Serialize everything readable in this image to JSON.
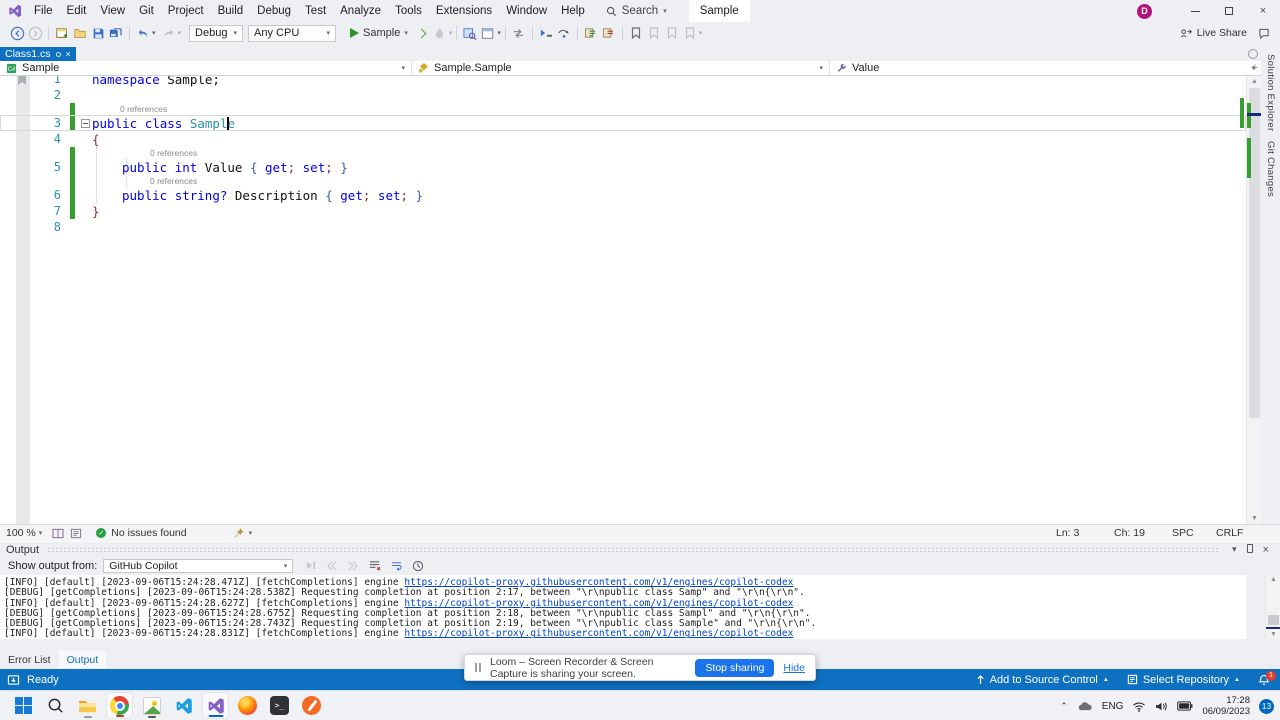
{
  "colors": {
    "accent": "#0e70c0",
    "keyword": "#0000ee",
    "type_name": "#2b91af",
    "changed_bar": "#35a02f",
    "log_link": "#0044cc",
    "share_button": "#1a73e8"
  },
  "titlebar": {
    "menus": [
      "File",
      "Edit",
      "View",
      "Git",
      "Project",
      "Build",
      "Debug",
      "Test",
      "Analyze",
      "Tools",
      "Extensions",
      "Window",
      "Help"
    ],
    "search": "Search",
    "solution": "Sample",
    "avatar": "D",
    "live_share": "Live Share"
  },
  "toolbar": {
    "config": "Debug",
    "platform": "Any CPU",
    "run": "Sample"
  },
  "doc_tab": "Class1.cs",
  "navbar": {
    "project": "Sample",
    "type": "Sample.Sample",
    "member": "Value"
  },
  "editor": {
    "codelens": "0 references",
    "lines": [
      {
        "n": "1",
        "tokens": [
          [
            "k",
            "namespace"
          ],
          [
            "p",
            " Sample;"
          ]
        ]
      },
      {
        "n": "2",
        "tokens": []
      },
      {
        "n": "3",
        "codelens": true,
        "changed": true,
        "current": true,
        "outline": true,
        "tokens": [
          [
            "k",
            "public"
          ],
          [
            "p",
            " "
          ],
          [
            "k",
            "class"
          ],
          [
            "p",
            " "
          ],
          [
            "t",
            "Sample"
          ]
        ]
      },
      {
        "n": "4",
        "tokens": [
          [
            "b",
            "{"
          ]
        ]
      },
      {
        "n": "5",
        "codelens": true,
        "changed": true,
        "indent": 1,
        "tokens": [
          [
            "k",
            "public"
          ],
          [
            "p",
            " "
          ],
          [
            "k",
            "int"
          ],
          [
            "p",
            " "
          ],
          [
            "p",
            "Value "
          ],
          [
            "q",
            "{ "
          ],
          [
            "k",
            "get"
          ],
          [
            "b",
            "; "
          ],
          [
            "k",
            "set"
          ],
          [
            "b",
            "; "
          ],
          [
            "q",
            "}"
          ]
        ]
      },
      {
        "n": "6",
        "codelens": true,
        "changed": true,
        "indent": 1,
        "tokens": [
          [
            "k",
            "public"
          ],
          [
            "p",
            " "
          ],
          [
            "k",
            "string"
          ],
          [
            "k",
            "?"
          ],
          [
            "p",
            " Description "
          ],
          [
            "q",
            "{ "
          ],
          [
            "k",
            "get"
          ],
          [
            "b",
            "; "
          ],
          [
            "k",
            "set"
          ],
          [
            "b",
            "; "
          ],
          [
            "q",
            "}"
          ]
        ]
      },
      {
        "n": "7",
        "changed": true,
        "tokens": [
          [
            "b",
            "}"
          ]
        ]
      },
      {
        "n": "8",
        "tokens": []
      }
    ],
    "status": {
      "zoom": "100 %",
      "health": "No issues found",
      "ln": "Ln: 3",
      "ch": "Ch: 19",
      "ins": "SPC",
      "eol": "CRLF"
    }
  },
  "side_rail": {
    "tabs": [
      "Solution Explorer",
      "Git Changes"
    ]
  },
  "output": {
    "title": "Output",
    "from_label": "Show output from:",
    "source": "GitHub Copilot",
    "lines": [
      {
        "pre": "[INFO] [default] [2023-09-06T15:24:28.471Z] [fetchCompletions] engine ",
        "url": "https://copilot-proxy.githubusercontent.com/v1/engines/copilot-codex"
      },
      {
        "pre": "[DEBUG] [getCompletions] [2023-09-06T15:24:28.538Z] Requesting completion at position 2:17, between \"\\r\\npublic class Samp\" and \"\\r\\n{\\r\\n\"."
      },
      {
        "pre": "[INFO] [default] [2023-09-06T15:24:28.627Z] [fetchCompletions] engine ",
        "url": "https://copilot-proxy.githubusercontent.com/v1/engines/copilot-codex"
      },
      {
        "pre": "[DEBUG] [getCompletions] [2023-09-06T15:24:28.675Z] Requesting completion at position 2:18, between \"\\r\\npublic class Sampl\" and \"\\r\\n{\\r\\n\"."
      },
      {
        "pre": "[DEBUG] [getCompletions] [2023-09-06T15:24:28.743Z] Requesting completion at position 2:19, between \"\\r\\npublic class Sample\" and \"\\r\\n{\\r\\n\"."
      },
      {
        "pre": "[INFO] [default] [2023-09-06T15:24:28.831Z] [fetchCompletions] engine ",
        "url": "https://copilot-proxy.githubusercontent.com/v1/engines/copilot-codex"
      }
    ]
  },
  "bottom_tabs": {
    "error_list": "Error List",
    "output": "Output"
  },
  "status_bar": {
    "ready": "Ready",
    "add_source_control": "Add to Source Control",
    "select_repository": "Select Repository",
    "notifications_badge": "1"
  },
  "notification": {
    "message": "Loom – Screen Recorder & Screen Capture is sharing your screen.",
    "stop_button": "Stop sharing",
    "hide_link": "Hide"
  },
  "taskbar": {
    "tray": {
      "language": "ENG",
      "time": "17:28",
      "date": "06/09/2023",
      "badge": "13"
    }
  }
}
